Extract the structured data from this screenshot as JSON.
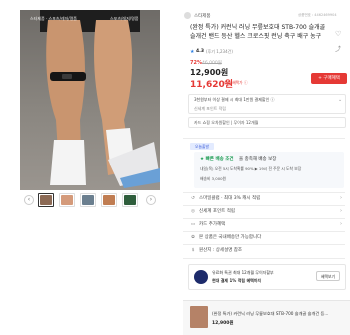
{
  "main_image": {
    "left_tag": "스타제품 · 스포츠/레저/명품",
    "right_tag": "스포츠/레저/명품"
  },
  "seller": {
    "name": "스타제품",
    "code": "상품번호 : 4462469904"
  },
  "product": {
    "title": "(완정 특가) 커런닉 러닝 무릎보호대 STB-700 슬개골 슬개건 밴드 등산 헬스 크로스핏 런닝 축구 배구 농구",
    "rating": "4.3",
    "reviews": "(후기 1,234건)",
    "discount": "72%",
    "original_price": "46,000원",
    "price": "12,900원",
    "coupon_price": "11,620원",
    "coupon_note": "최대 혜택가 ⓘ",
    "buy_button": "+ 구매혜택"
  },
  "benefit_box": {
    "line1": "3천원부터 이상 결제 시 최대 1만원 결제할인 ⓘ",
    "line2": "신세계 포인트 적립"
  },
  "card_box": {
    "line1": "카드 쇼핑 오차원할인 | 무이자 12개월"
  },
  "delivery": {
    "badge": "오늘출발",
    "free_label": "★ 빠른 배송 조건",
    "free_text": "을 충족해 배송 보장",
    "line2": "내일(목) 오전 5시 도착확률 90% ▶ 19시 전 주문 시 도착 보장",
    "line3": "배송비 3,000원"
  },
  "menu": [
    {
      "icon": "↺",
      "label": "스마일클럽 · 최대 3% 캐시 적립"
    },
    {
      "icon": "◎",
      "label": "신세계 포인트 적립"
    },
    {
      "icon": "▭",
      "label": "카드 추가혜택"
    },
    {
      "icon": "✿",
      "label": "본 상품은 국내배송만 가능합니다"
    },
    {
      "icon": "$",
      "label": "원산지 : 상세설명 참조"
    }
  ],
  "promo": {
    "line1": "유료화 특권 최대 12개월 무이자할부",
    "line2": "현대 결제 1% 적립 혜택까지",
    "button": "혜택보기"
  },
  "bottom": {
    "title": "(완정 특가) 커런닉 러닝 무릎보호대 STB-700 슬개골 슬개건 등...",
    "price": "12,900원"
  }
}
